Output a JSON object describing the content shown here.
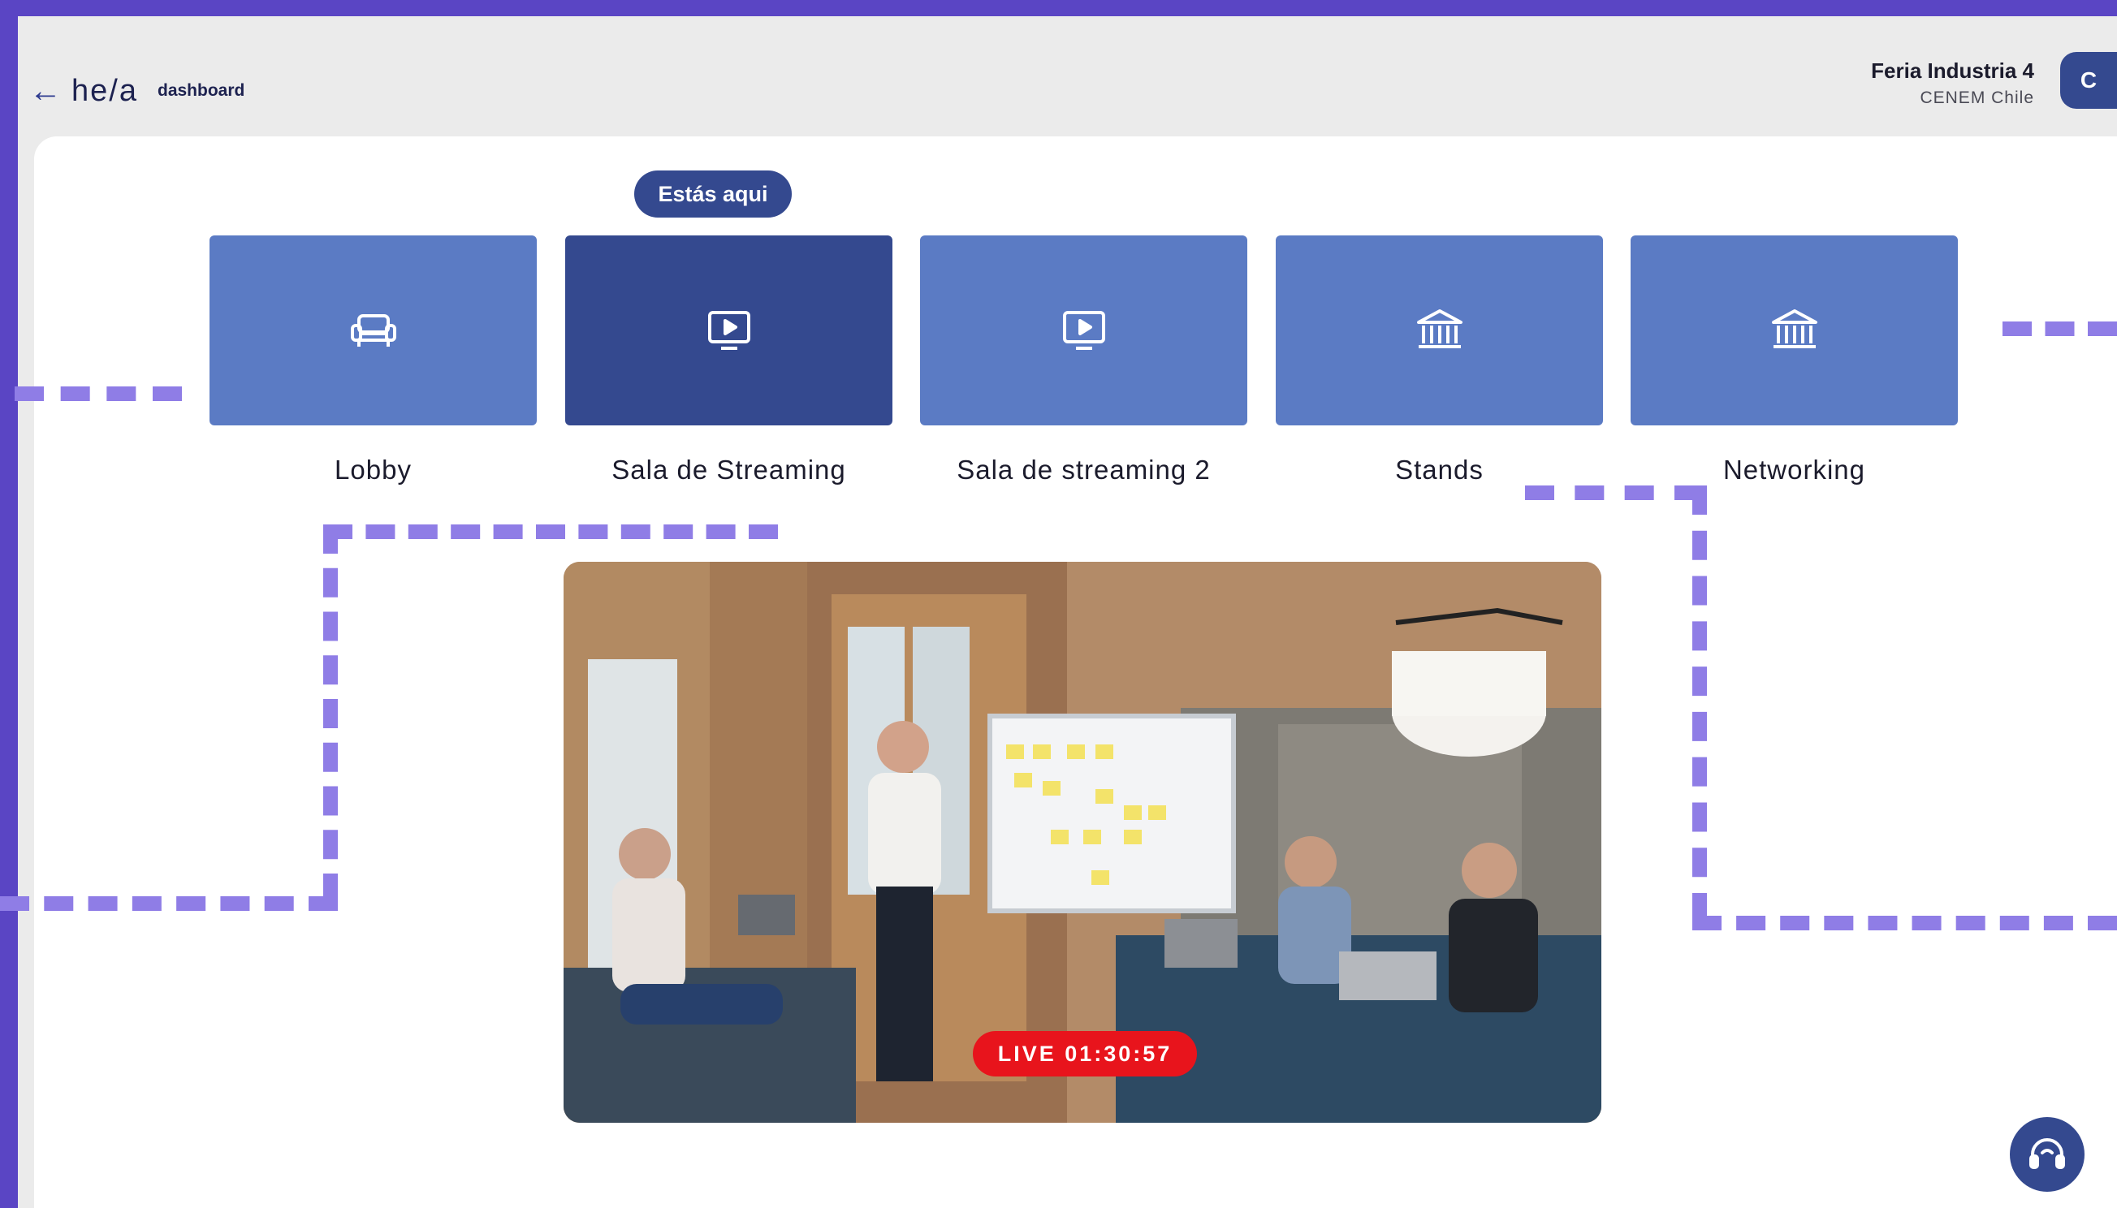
{
  "header": {
    "back_icon": "arrow-left-icon",
    "logo": "he/a",
    "breadcrumb": "dashboard",
    "event_name": "Feria Industria 4",
    "event_org": "CENEM Chile",
    "avatar_initial": "C"
  },
  "navigation": {
    "here_badge": "Estás aqui",
    "tiles": [
      {
        "label": "Lobby",
        "icon": "sofa-icon",
        "active": false
      },
      {
        "label": "Sala de Streaming",
        "icon": "play-screen-icon",
        "active": true
      },
      {
        "label": "Sala de streaming 2",
        "icon": "play-screen-icon",
        "active": false
      },
      {
        "label": "Stands",
        "icon": "building-columns-icon",
        "active": false
      },
      {
        "label": "Networking",
        "icon": "building-columns-icon",
        "active": false
      }
    ]
  },
  "stream": {
    "live_label": "LIVE 01:30:57"
  },
  "help_icon": "headset-icon",
  "colors": {
    "accent_dark": "#34498f",
    "tile": "#5b7bc4",
    "live": "#e8141c",
    "dots": "#8f7de6",
    "frame": "#5a45c4"
  }
}
